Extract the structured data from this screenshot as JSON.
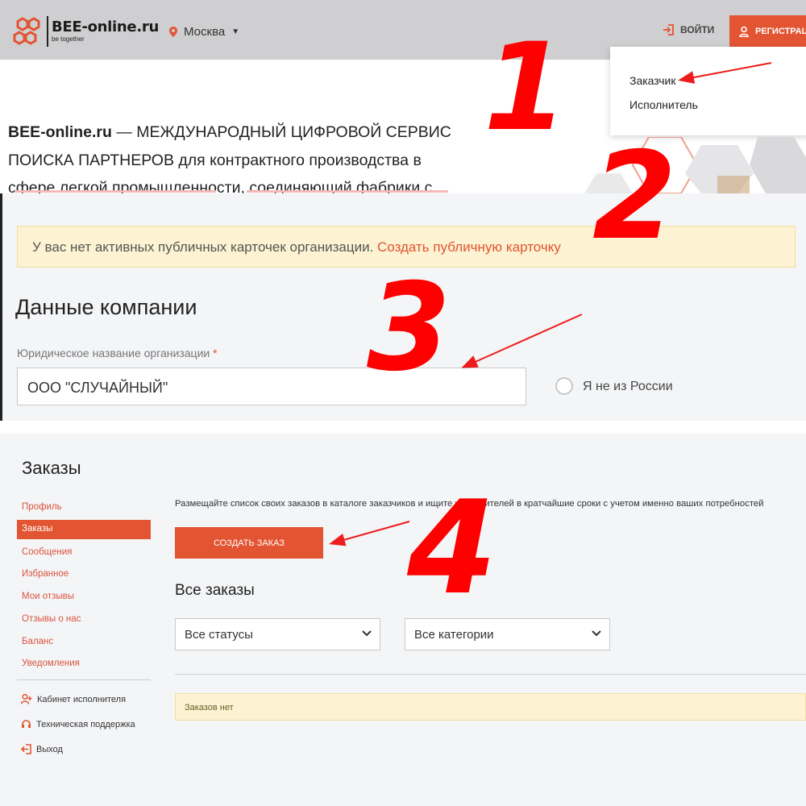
{
  "header": {
    "logo_name": "BEE-online.ru",
    "logo_tagline": "be together",
    "city": "Москва",
    "login_label": "ВОЙТИ",
    "register_label": "РЕГИСТРАЦ",
    "accent_color": "#e25432"
  },
  "role_dropdown": {
    "options": [
      "Заказчик",
      "Исполнитель"
    ]
  },
  "hero": {
    "brand": "BEE-online.ru",
    "line1_rest": " — МЕЖДУНАРОДНЫЙ ЦИФРОВОЙ СЕРВИС",
    "line2": "ПОИСКА ПАРТНЕРОВ для контрактного производства в",
    "line3": "сфере легкой промышленности, соединяющий фабрики с"
  },
  "company": {
    "notice_text": "У вас нет активных публичных карточек организации. ",
    "notice_link": "Создать публичную карточку",
    "title": "Данные компании",
    "field_label": "Юридическое название организации",
    "required_mark": "*",
    "field_value": "ООО \"СЛУЧАЙНЫЙ\"",
    "not_russia_label": "Я не из России"
  },
  "orders": {
    "title": "Заказы",
    "menu": [
      "Профиль",
      "Заказы",
      "Сообщения",
      "Избранное",
      "Мои отзывы",
      "Отзывы о нас",
      "Баланс",
      "Уведомления"
    ],
    "active_menu": "Заказы",
    "side_links": [
      "Кабинет исполнителя",
      "Техническая поддержка",
      "Выход"
    ],
    "intro": "Размещайте список своих заказов в каталоге заказчиков и ищите исполнителей в кратчайшие сроки с учетом именно ваших потребностей",
    "create_button": "СОЗДАТЬ ЗАКАЗ",
    "all_orders_title": "Все заказы",
    "status_filter": "Все статусы",
    "category_filter": "Все категории",
    "empty_message": "Заказов нет"
  },
  "annotations": {
    "step_numbers": [
      "1",
      "2",
      "3",
      "4"
    ],
    "color": "#ff0000"
  }
}
